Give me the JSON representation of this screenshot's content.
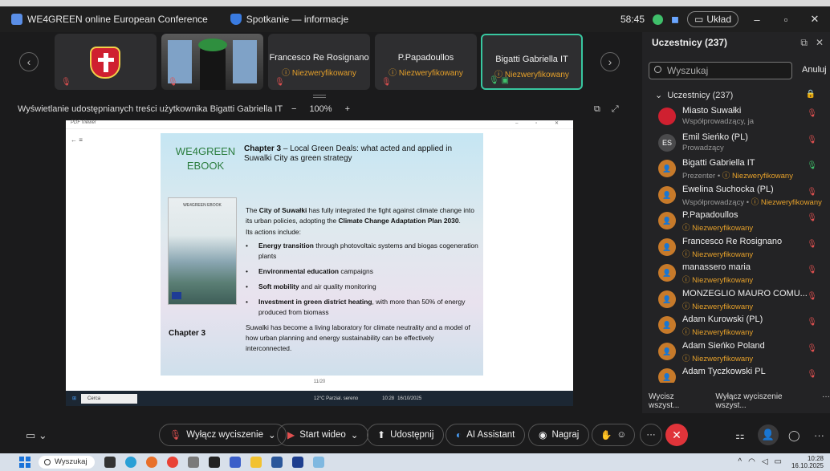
{
  "window": {
    "tabs": [
      {
        "label": "WE4GREEN online European Conference",
        "icon": "app-icon"
      },
      {
        "label": "Spotkanie — informacje",
        "icon": "shield-icon"
      }
    ],
    "timer": "58:45",
    "layout_label": "Układ"
  },
  "thumbnails": [
    {
      "name": "",
      "kind": "crest"
    },
    {
      "name": "",
      "kind": "camera"
    },
    {
      "name": "Francesco Re Rosignano",
      "status": "Niezweryfikowany"
    },
    {
      "name": "P.Papadoullos",
      "status": "Niezweryfikowany"
    },
    {
      "name": "Bigatti Gabriella IT",
      "status": "Niezweryfikowany"
    }
  ],
  "share": {
    "label": "Wyświetlanie udostępnianych treści użytkownika Bigatti Gabriella IT",
    "zoom_minus": "−",
    "zoom": "100%",
    "zoom_plus": "+"
  },
  "shared_window": {
    "app_title": "PDF Viewer",
    "slide": {
      "brand": "WE4GREEN EBOOK",
      "chapter_bold": "Chapter 3",
      "chapter_rest": " – Local Green Deals: what acted and applied in Suwalki City as green strategy",
      "book_cover_title": "WE4GREEN EBOOK",
      "chapter_label": "Chapter 3",
      "intro_1": "The ",
      "intro_city": "City of Suwałki",
      "intro_2": " has fully integrated the fight against climate change into its urban policies, adopting the ",
      "intro_plan": "Climate Change Adaptation Plan 2030",
      "intro_3": ".",
      "actions_label": "Its actions include:",
      "bullets": [
        {
          "bold": "Energy transition",
          "rest": " through photovoltaic systems and biogas cogeneration plants"
        },
        {
          "bold": "Environmental education",
          "rest": " campaigns"
        },
        {
          "bold": "Soft mobility",
          "rest": " and air quality monitoring"
        },
        {
          "bold": "Investment in green district heating",
          "rest": ", with more than 50% of energy produced from biomass"
        }
      ],
      "closing": "Suwalki has become a living laboratory for climate neutrality and a model of how urban planning and energy sustainability can be effectively interconnected."
    },
    "page_indicator": "11/20",
    "inner_search": "Cerca",
    "inner_weather": "12°C Parzial. sereno",
    "inner_time": "10:28",
    "inner_date": "16/10/2025"
  },
  "participants": {
    "title": "Uczestnicy (237)",
    "search_placeholder": "Wyszukaj",
    "cancel": "Anuluj",
    "group": "Uczestnicy (237)",
    "list": [
      {
        "name": "Miasto Suwałki",
        "role": "Współprowadzący, ja",
        "status": "",
        "avatar": "crest",
        "mic": "muted"
      },
      {
        "name": "Emil Sieńko (PL)",
        "role": "Prowadzący",
        "status": "",
        "avatar": "ES",
        "mic": "muted"
      },
      {
        "name": "Bigatti Gabriella IT",
        "role": "Prezenter • ",
        "status": "Niezweryfikowany",
        "avatar": "person",
        "mic": "on"
      },
      {
        "name": "Ewelina Suchocka (PL)",
        "role": "Współprowadzący • ",
        "status": "Niezweryfikowany",
        "avatar": "person",
        "mic": "muted"
      },
      {
        "name": "P.Papadoullos",
        "role": "",
        "status": "Niezweryfikowany",
        "avatar": "person",
        "mic": "muted"
      },
      {
        "name": "Francesco Re Rosignano",
        "role": "",
        "status": "Niezweryfikowany",
        "avatar": "person",
        "mic": "muted"
      },
      {
        "name": "manassero maria",
        "role": "",
        "status": "Niezweryfikowany",
        "avatar": "person",
        "mic": "muted"
      },
      {
        "name": "MONZEGLIO MAURO COMU...",
        "role": "",
        "status": "Niezweryfikowany",
        "avatar": "person",
        "mic": "muted"
      },
      {
        "name": "Adam Kurowski (PL)",
        "role": "",
        "status": "Niezweryfikowany",
        "avatar": "person",
        "mic": "muted"
      },
      {
        "name": "Adam Sieńko Poland",
        "role": "",
        "status": "Niezweryfikowany",
        "avatar": "person",
        "mic": "muted"
      },
      {
        "name": "Adam Tyczkowski PL",
        "role": "",
        "status": "Niezweryfikowany",
        "avatar": "person",
        "mic": "muted"
      }
    ],
    "mute_all": "Wycisz wszyst...",
    "unmute_all": "Wyłącz wyciszenie wszyst...",
    "more": "···"
  },
  "controls": {
    "mute": "Wyłącz wyciszenie",
    "video": "Start wideo",
    "share": "Udostępnij",
    "ai": "AI Assistant",
    "record": "Nagraj"
  },
  "taskbar": {
    "search": "Wyszukaj",
    "time": "10:28",
    "date": "16.10.2025"
  },
  "colors": {
    "accent_green": "#38c7a0",
    "unverified_orange": "#e5a02a",
    "muted_red": "#e05050",
    "end_red": "#e0343a",
    "brand_green": "#2b7d3e"
  }
}
